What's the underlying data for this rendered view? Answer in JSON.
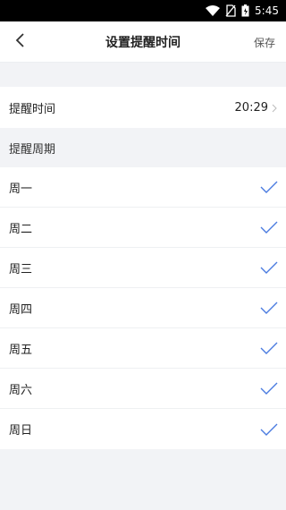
{
  "status_bar": {
    "time": "5:45",
    "icons": [
      "wifi-icon",
      "no-sim-icon",
      "battery-icon"
    ]
  },
  "header": {
    "back_icon": "chevron-left-icon",
    "title": "设置提醒时间",
    "save_label": "保存"
  },
  "reminder_time": {
    "label": "提醒时间",
    "value": "20:29",
    "arrow_icon": "chevron-right-icon"
  },
  "period": {
    "section_label": "提醒周期",
    "days": [
      {
        "label": "周一",
        "checked": true
      },
      {
        "label": "周二",
        "checked": true
      },
      {
        "label": "周三",
        "checked": true
      },
      {
        "label": "周四",
        "checked": true
      },
      {
        "label": "周五",
        "checked": true
      },
      {
        "label": "周六",
        "checked": true
      },
      {
        "label": "周日",
        "checked": true
      }
    ]
  },
  "colors": {
    "check": "#4a7be0",
    "background": "#f2f3f6"
  }
}
